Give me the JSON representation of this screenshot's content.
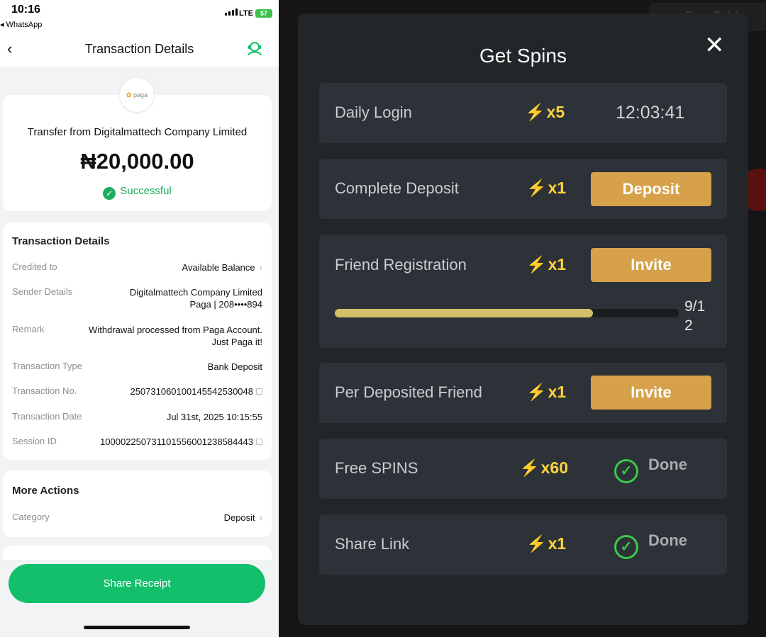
{
  "left": {
    "status_bar": {
      "time": "10:16",
      "back_app": "◂ WhatsApp",
      "network": "LTE",
      "battery": "57"
    },
    "navbar": {
      "back_icon": "‹",
      "title": "Transaction Details"
    },
    "logo_text": "paga",
    "summary": {
      "from": "Transfer from Digitalmattech Company Limited",
      "amount": "₦20,000.00",
      "status": "Successful"
    },
    "details": {
      "title": "Transaction Details",
      "rows": [
        {
          "key": "Credited to",
          "value": "Available Balance"
        },
        {
          "key": "Sender Details",
          "value": "Digitalmattech Company Limited",
          "value2": "Paga | 208••••894"
        },
        {
          "key": "Remark",
          "value": "Withdrawal processed from Paga Account.",
          "value2": "Just Paga it!"
        },
        {
          "key": "Transaction Type",
          "value": "Bank Deposit"
        },
        {
          "key": "Transaction No.",
          "value": "250731060100145542530048"
        },
        {
          "key": "Transaction Date",
          "value": "Jul 31st, 2025 10:15:55"
        },
        {
          "key": "Session ID",
          "value": "100002250731101556001238584443"
        }
      ]
    },
    "more_actions": {
      "title": "More Actions",
      "category_key": "Category",
      "category_value": "Deposit"
    },
    "share_button": "Share Receipt",
    "colors": {
      "accent": "#13bf6b",
      "success": "#1aae5e"
    }
  },
  "right": {
    "background_pay_table": "Pay Table",
    "modal": {
      "title": "Get Spins",
      "close_icon": "✕",
      "tasks": [
        {
          "name": "Daily Login",
          "multiplier": "x5",
          "timer": "12:03:41"
        },
        {
          "name": "Complete Deposit",
          "multiplier": "x1",
          "button": "Deposit"
        },
        {
          "name": "Friend Registration",
          "multiplier": "x1",
          "button": "Invite",
          "progress_text": "9/12",
          "progress_fraction": 0.75
        },
        {
          "name": "Per Deposited Friend",
          "multiplier": "x1",
          "button": "Invite"
        },
        {
          "name": "Free SPINS",
          "multiplier": "x60",
          "status": "Done"
        },
        {
          "name": "Share Link",
          "multiplier": "x1",
          "status": "Done"
        }
      ]
    },
    "colors": {
      "button": "#d6a14a",
      "multiplier": "#ffd33d",
      "done": "#3ec94c",
      "panel": "#2c3238"
    },
    "icons": {
      "bolt": "⚡",
      "check": "✓"
    }
  }
}
